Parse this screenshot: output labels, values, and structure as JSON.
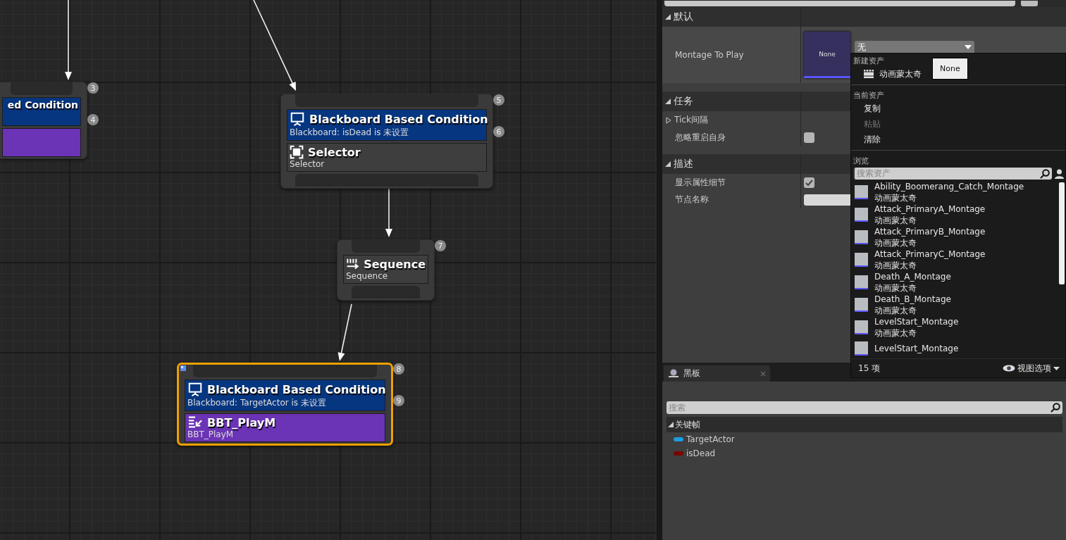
{
  "graph": {
    "nodes": [
      {
        "decorator": {
          "title": "ed Condition"
        },
        "main": {
          "kind": "task"
        },
        "badges": [
          "3",
          "4"
        ],
        "selected": false
      },
      {
        "decorator": {
          "title": "Blackboard Based Condition",
          "subtitle": "Blackboard: isDead is 未设置"
        },
        "main": {
          "kind": "selector",
          "title": "Selector",
          "subtitle": "Selector"
        },
        "badges": [
          "5",
          "6"
        ],
        "selected": false
      },
      {
        "main": {
          "kind": "sequence",
          "title": "Sequence",
          "subtitle": "Sequence"
        },
        "badges": [
          "7"
        ],
        "selected": false
      },
      {
        "decorator": {
          "title": "Blackboard Based Condition",
          "subtitle": "Blackboard: TargetActor is 未设置"
        },
        "main": {
          "kind": "task",
          "title": "BBT_PlayM",
          "subtitle": "BBT_PlayM"
        },
        "badges": [
          "8",
          "9"
        ],
        "selected": true
      }
    ]
  },
  "details": {
    "sections": [
      {
        "title": "默认",
        "expanded": true,
        "rows": [
          {
            "kind": "asset",
            "label": "Montage To Play",
            "thumbnail_text": "None",
            "value": "无"
          }
        ]
      },
      {
        "title": "任务",
        "expanded": true,
        "rows": [
          {
            "kind": "group",
            "label": "Tick间隔",
            "expanded": false
          },
          {
            "kind": "checkbox",
            "label": "忽略重启自身",
            "checked": false
          }
        ]
      },
      {
        "title": "描述",
        "expanded": true,
        "rows": [
          {
            "kind": "checkbox",
            "label": "显示属性细节",
            "checked": true
          },
          {
            "kind": "text",
            "label": "节点名称"
          }
        ]
      }
    ]
  },
  "asset_picker": {
    "new_label": "新建资产",
    "new_item": "动画蒙太奇",
    "tooltip": "None",
    "current_label": "当前资产",
    "actions": [
      {
        "label": "复制",
        "disabled": false
      },
      {
        "label": "粘贴",
        "disabled": true
      },
      {
        "label": "清除",
        "disabled": false
      }
    ],
    "browse_label": "浏览",
    "search": {
      "placeholder": "搜索资产"
    },
    "assets": [
      {
        "name": "Ability_Boomerang_Catch_Montage",
        "type": "动画蒙太奇"
      },
      {
        "name": "Attack_PrimaryA_Montage",
        "type": "动画蒙太奇"
      },
      {
        "name": "Attack_PrimaryB_Montage",
        "type": "动画蒙太奇"
      },
      {
        "name": "Attack_PrimaryC_Montage",
        "type": "动画蒙太奇"
      },
      {
        "name": "Death_A_Montage",
        "type": "动画蒙太奇"
      },
      {
        "name": "Death_B_Montage",
        "type": "动画蒙太奇"
      },
      {
        "name": "LevelStart_Montage",
        "type": "动画蒙太奇"
      },
      {
        "name": "LevelStart_Montage"
      }
    ],
    "count": "15 项",
    "view_options": "视图选项"
  },
  "blackboard": {
    "tab": "黑板",
    "search": {
      "placeholder": "搜索"
    },
    "category": {
      "title": "关键帧",
      "expanded": true,
      "keys": [
        {
          "name": "TargetActor",
          "color": "#1a9ee0"
        },
        {
          "name": "isDead",
          "color": "#7a0000"
        }
      ]
    }
  }
}
